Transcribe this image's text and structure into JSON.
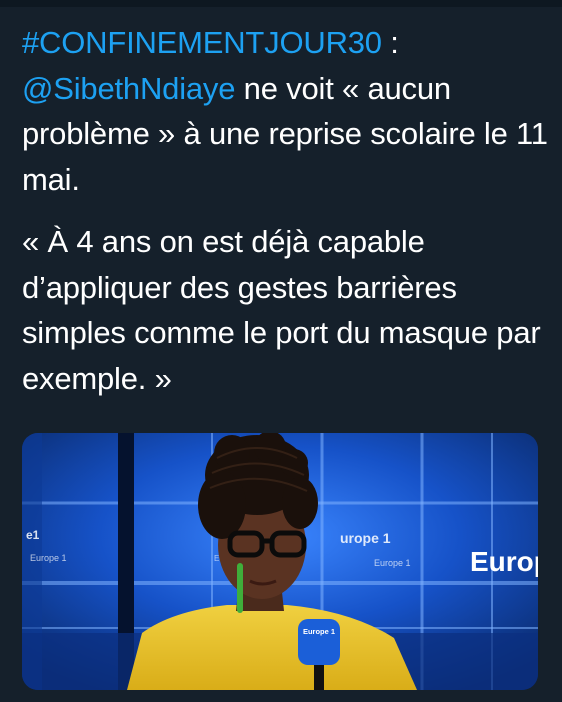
{
  "tweet": {
    "hashtag": "#CONFINEMENTJOUR30",
    "hashtag_suffix": " :",
    "mention": "@SibethNdiaye",
    "line1_rest": " ne voit « aucun problème » à une reprise scolaire le 11 mai.",
    "quote": "« À 4 ans on est déjà capable d’appliquer des gestes barrières simples comme le port du masque par exemple. »"
  },
  "media": {
    "background_brand": "Europ",
    "microphone_brand": "Europe 1",
    "studio_signs": [
      "e1",
      "Europe 1",
      "urope 1",
      "Europe 1",
      "Europe 1"
    ]
  },
  "colors": {
    "background": "#15202b",
    "text": "#ffffff",
    "link": "#1da1f2",
    "studio_blue": "#1652c8",
    "jacket_yellow": "#e9c52a"
  }
}
